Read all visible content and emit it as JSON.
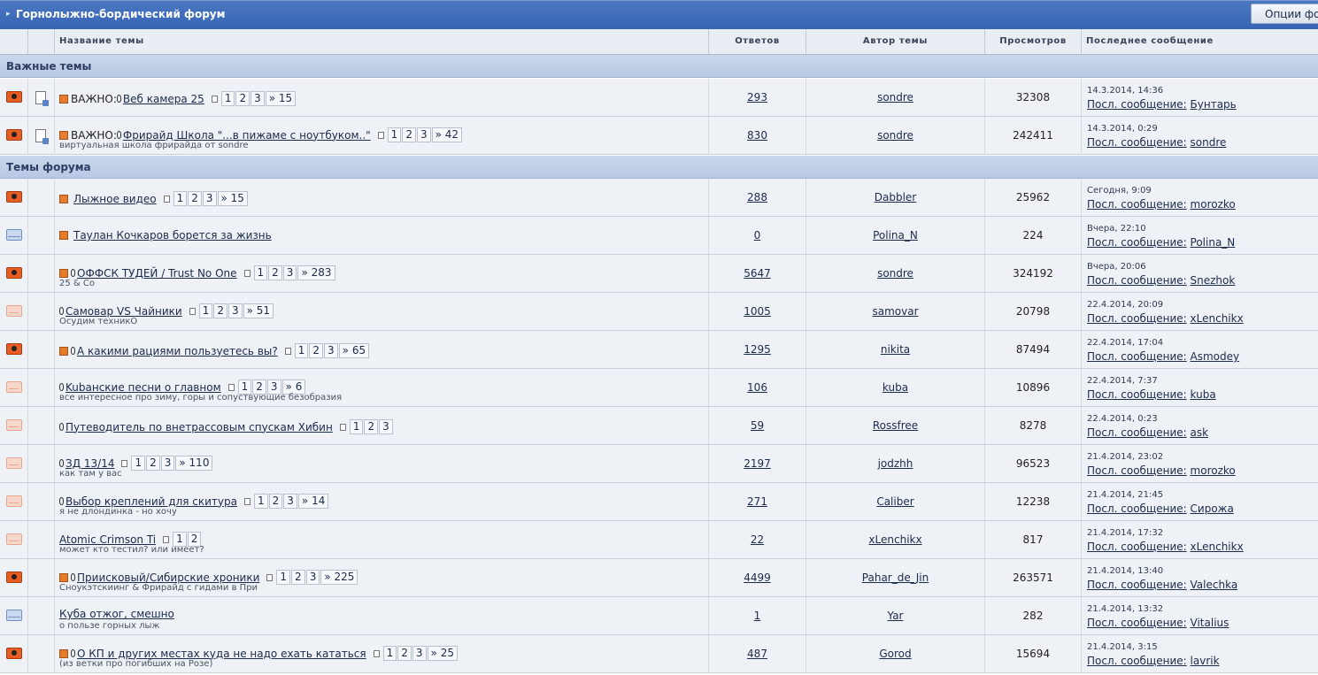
{
  "forum": {
    "title": "Горнолыжно-бордический форум",
    "options_label": "Опции фор"
  },
  "columns": {
    "topic": "Название темы",
    "replies": "Ответов",
    "author": "Автор темы",
    "views": "Просмотров",
    "last": "Последнее сообщение"
  },
  "sections": {
    "important": "Важные темы",
    "forum_topics": "Темы форума"
  },
  "last_post_label": "Посл. сообщение:",
  "topics": [
    {
      "icon": "hot",
      "doc": true,
      "prefix_icon": true,
      "prefix": "ВАЖНО:",
      "lead": true,
      "title": "Веб камера 25",
      "pages": [
        "1",
        "2",
        "3",
        "» 15"
      ],
      "desc": "",
      "replies": "293",
      "author": "sondre",
      "views": "32308",
      "last_date": "14.3.2014, 14:36",
      "last_user": "Бунтарь"
    },
    {
      "icon": "hot",
      "doc": true,
      "prefix_icon": true,
      "prefix": "ВАЖНО:",
      "lead": true,
      "title": "Фрирайд Школа \"...в пижаме с ноутбуком..\"",
      "pages": [
        "1",
        "2",
        "3",
        "» 42"
      ],
      "desc": "виртуальная школа фрирайда от sondre",
      "replies": "830",
      "author": "sondre",
      "views": "242411",
      "last_date": "14.3.2014, 0:29",
      "last_user": "sondre"
    },
    {
      "icon": "hot",
      "doc": false,
      "prefix_icon": true,
      "prefix": "",
      "lead": false,
      "title": "Лыжное видео",
      "pages": [
        "1",
        "2",
        "3",
        "» 15"
      ],
      "desc": "",
      "replies": "288",
      "author": "Dabbler",
      "views": "25962",
      "last_date": "Сегодня, 9:09",
      "last_user": "morozko"
    },
    {
      "icon": "blue",
      "doc": false,
      "prefix_icon": true,
      "prefix": "",
      "lead": false,
      "title": "Таулан Кочкаров борется за жизнь",
      "pages": [],
      "desc": "",
      "replies": "0",
      "author": "Polina_N",
      "views": "224",
      "last_date": "Вчера, 22:10",
      "last_user": "Polina_N"
    },
    {
      "icon": "hot",
      "doc": false,
      "prefix_icon": true,
      "prefix": "",
      "lead": true,
      "title": "ОФФСК ТУДЕЙ / Trust No One",
      "pages": [
        "1",
        "2",
        "3",
        "» 283"
      ],
      "desc": "25 & Co",
      "replies": "5647",
      "author": "sondre",
      "views": "324192",
      "last_date": "Вчера, 20:06",
      "last_user": "Snezhok"
    },
    {
      "icon": "cold",
      "doc": false,
      "prefix_icon": false,
      "prefix": "",
      "lead": true,
      "title": "Самовар VS Чайники",
      "pages": [
        "1",
        "2",
        "3",
        "» 51"
      ],
      "desc": "Осудим техникО",
      "replies": "1005",
      "author": "samovar",
      "views": "20798",
      "last_date": "22.4.2014, 20:09",
      "last_user": "xLenchikx"
    },
    {
      "icon": "hot",
      "doc": false,
      "prefix_icon": true,
      "prefix": "",
      "lead": true,
      "title": "А какими рациями пользуетесь вы?",
      "pages": [
        "1",
        "2",
        "3",
        "» 65"
      ],
      "desc": "",
      "replies": "1295",
      "author": "nikita",
      "views": "87494",
      "last_date": "22.4.2014, 17:04",
      "last_user": "Asmodey"
    },
    {
      "icon": "cold",
      "doc": false,
      "prefix_icon": false,
      "prefix": "",
      "lead": true,
      "title": "Kubaнские песни о главном",
      "pages": [
        "1",
        "2",
        "3",
        "» 6"
      ],
      "desc": "все интересное про зиму, горы и сопуствующие безобразия",
      "replies": "106",
      "author": "kuba",
      "views": "10896",
      "last_date": "22.4.2014, 7:37",
      "last_user": "kuba"
    },
    {
      "icon": "cold",
      "doc": false,
      "prefix_icon": false,
      "prefix": "",
      "lead": true,
      "title": "Путеводитель по внетрассовым спускам Хибин",
      "pages": [
        "1",
        "2",
        "3"
      ],
      "desc": "",
      "replies": "59",
      "author": "Rossfree",
      "views": "8278",
      "last_date": "22.4.2014, 0:23",
      "last_user": "ask"
    },
    {
      "icon": "cold",
      "doc": false,
      "prefix_icon": false,
      "prefix": "",
      "lead": true,
      "title": "ЗД 13/14",
      "pages": [
        "1",
        "2",
        "3",
        "» 110"
      ],
      "desc": "как там у вас",
      "replies": "2197",
      "author": "jodzhh",
      "views": "96523",
      "last_date": "21.4.2014, 23:02",
      "last_user": "morozko"
    },
    {
      "icon": "cold",
      "doc": false,
      "prefix_icon": false,
      "prefix": "",
      "lead": true,
      "title": "Выбор креплений для скитура",
      "pages": [
        "1",
        "2",
        "3",
        "» 14"
      ],
      "desc": "я не длондинка - но хочу",
      "replies": "271",
      "author": "Caliber",
      "views": "12238",
      "last_date": "21.4.2014, 21:45",
      "last_user": "Сирожа"
    },
    {
      "icon": "cold",
      "doc": false,
      "prefix_icon": false,
      "prefix": "",
      "lead": false,
      "title": "Atomic Crimson Ti",
      "pages": [
        "1",
        "2"
      ],
      "desc": "может кто тестил? или имеет?",
      "replies": "22",
      "author": "xLenchikx",
      "views": "817",
      "last_date": "21.4.2014, 17:32",
      "last_user": "xLenchikx"
    },
    {
      "icon": "hot",
      "doc": false,
      "prefix_icon": true,
      "prefix": "",
      "lead": true,
      "title": "Приисковый/Сибирские хроники",
      "pages": [
        "1",
        "2",
        "3",
        "» 225"
      ],
      "desc": "Сноукэтскиинг & Фрирайд с гидами в При",
      "replies": "4499",
      "author": "Pahar_de_Jin",
      "views": "263571",
      "last_date": "21.4.2014, 13:40",
      "last_user": "Valechka"
    },
    {
      "icon": "blue",
      "doc": false,
      "prefix_icon": false,
      "prefix": "",
      "lead": false,
      "title": "Куба отжог, смешно",
      "pages": [],
      "desc": "о пользе горных лыж",
      "replies": "1",
      "author": "Yar",
      "views": "282",
      "last_date": "21.4.2014, 13:32",
      "last_user": "Vitalius"
    },
    {
      "icon": "hot",
      "doc": false,
      "prefix_icon": true,
      "prefix": "",
      "lead": true,
      "title": "О КП и других местах куда не надо ехать кататься",
      "pages": [
        "1",
        "2",
        "3",
        "» 25"
      ],
      "desc": "(из ветки про погибших на Розе)",
      "replies": "487",
      "author": "Gorod",
      "views": "15694",
      "last_date": "21.4.2014, 3:15",
      "last_user": "lavrik"
    }
  ]
}
